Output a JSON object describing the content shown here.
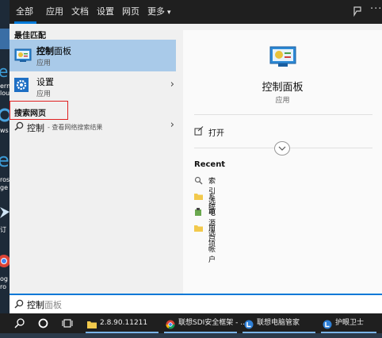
{
  "tabs": {
    "all": "全部",
    "apps": "应用",
    "docs": "文档",
    "settings": "设置",
    "web": "网页",
    "more": "更多",
    "more_caret": "▾"
  },
  "desktop_fragments": [
    "ern",
    "lou",
    "ws",
    "ros",
    "ge",
    "订",
    "og",
    "ro"
  ],
  "results": {
    "best_match_heading": "最佳匹配",
    "best_match": {
      "title_bold": "控制",
      "title_rest": "面板",
      "subtitle": "应用"
    },
    "settings_item": {
      "title": "设置",
      "subtitle": "应用"
    },
    "web_heading": "搜索网页",
    "web_item": {
      "title": "控制",
      "subtitle": " - 查看网络搜索结果"
    }
  },
  "detail": {
    "title": "控制面板",
    "subtitle": "应用",
    "open_label": "打开",
    "recent_heading": "Recent",
    "recent_items": [
      {
        "label": "索引选项",
        "icon": "index-options-icon"
      },
      {
        "label": "系统",
        "icon": "folder-icon"
      },
      {
        "label": "电源选项",
        "icon": "power-options-icon"
      },
      {
        "label": "用户帐户",
        "icon": "folder-icon"
      }
    ]
  },
  "search": {
    "query_bold": "控制",
    "query_rest": "面板"
  },
  "taskbar": {
    "apps": [
      {
        "label": "2.8.90.11211",
        "icon": "folder-icon"
      },
      {
        "label": "联想SDI安全框架 - ...",
        "icon": "chrome-icon"
      },
      {
        "label": "联想电脑管家",
        "icon": "lenovo-icon"
      },
      {
        "label": "护眼卫士",
        "icon": "eye-care-icon"
      }
    ]
  },
  "colors": {
    "accent": "#0078d7",
    "selected_bg": "#a9cae9",
    "highlight_box": "#e02020",
    "dark_bar": "#1f1f1f",
    "panel_bg": "#f0f0f0"
  }
}
